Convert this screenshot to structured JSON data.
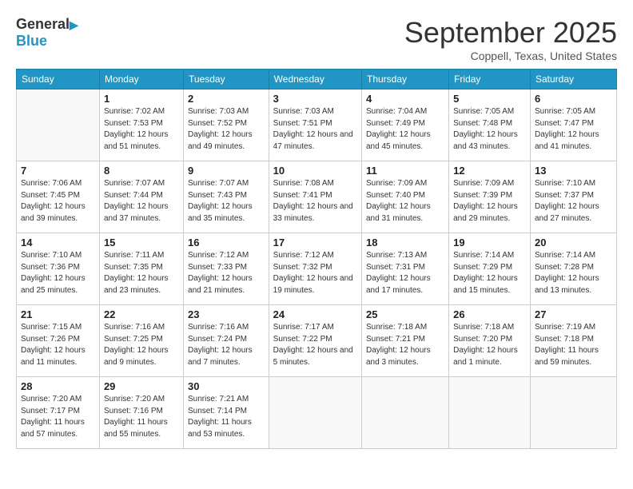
{
  "header": {
    "logo_line1": "General",
    "logo_line2": "Blue",
    "month": "September 2025",
    "location": "Coppell, Texas, United States"
  },
  "weekdays": [
    "Sunday",
    "Monday",
    "Tuesday",
    "Wednesday",
    "Thursday",
    "Friday",
    "Saturday"
  ],
  "weeks": [
    [
      {
        "day": "",
        "sunrise": "",
        "sunset": "",
        "daylight": ""
      },
      {
        "day": "1",
        "sunrise": "Sunrise: 7:02 AM",
        "sunset": "Sunset: 7:53 PM",
        "daylight": "Daylight: 12 hours and 51 minutes."
      },
      {
        "day": "2",
        "sunrise": "Sunrise: 7:03 AM",
        "sunset": "Sunset: 7:52 PM",
        "daylight": "Daylight: 12 hours and 49 minutes."
      },
      {
        "day": "3",
        "sunrise": "Sunrise: 7:03 AM",
        "sunset": "Sunset: 7:51 PM",
        "daylight": "Daylight: 12 hours and 47 minutes."
      },
      {
        "day": "4",
        "sunrise": "Sunrise: 7:04 AM",
        "sunset": "Sunset: 7:49 PM",
        "daylight": "Daylight: 12 hours and 45 minutes."
      },
      {
        "day": "5",
        "sunrise": "Sunrise: 7:05 AM",
        "sunset": "Sunset: 7:48 PM",
        "daylight": "Daylight: 12 hours and 43 minutes."
      },
      {
        "day": "6",
        "sunrise": "Sunrise: 7:05 AM",
        "sunset": "Sunset: 7:47 PM",
        "daylight": "Daylight: 12 hours and 41 minutes."
      }
    ],
    [
      {
        "day": "7",
        "sunrise": "Sunrise: 7:06 AM",
        "sunset": "Sunset: 7:45 PM",
        "daylight": "Daylight: 12 hours and 39 minutes."
      },
      {
        "day": "8",
        "sunrise": "Sunrise: 7:07 AM",
        "sunset": "Sunset: 7:44 PM",
        "daylight": "Daylight: 12 hours and 37 minutes."
      },
      {
        "day": "9",
        "sunrise": "Sunrise: 7:07 AM",
        "sunset": "Sunset: 7:43 PM",
        "daylight": "Daylight: 12 hours and 35 minutes."
      },
      {
        "day": "10",
        "sunrise": "Sunrise: 7:08 AM",
        "sunset": "Sunset: 7:41 PM",
        "daylight": "Daylight: 12 hours and 33 minutes."
      },
      {
        "day": "11",
        "sunrise": "Sunrise: 7:09 AM",
        "sunset": "Sunset: 7:40 PM",
        "daylight": "Daylight: 12 hours and 31 minutes."
      },
      {
        "day": "12",
        "sunrise": "Sunrise: 7:09 AM",
        "sunset": "Sunset: 7:39 PM",
        "daylight": "Daylight: 12 hours and 29 minutes."
      },
      {
        "day": "13",
        "sunrise": "Sunrise: 7:10 AM",
        "sunset": "Sunset: 7:37 PM",
        "daylight": "Daylight: 12 hours and 27 minutes."
      }
    ],
    [
      {
        "day": "14",
        "sunrise": "Sunrise: 7:10 AM",
        "sunset": "Sunset: 7:36 PM",
        "daylight": "Daylight: 12 hours and 25 minutes."
      },
      {
        "day": "15",
        "sunrise": "Sunrise: 7:11 AM",
        "sunset": "Sunset: 7:35 PM",
        "daylight": "Daylight: 12 hours and 23 minutes."
      },
      {
        "day": "16",
        "sunrise": "Sunrise: 7:12 AM",
        "sunset": "Sunset: 7:33 PM",
        "daylight": "Daylight: 12 hours and 21 minutes."
      },
      {
        "day": "17",
        "sunrise": "Sunrise: 7:12 AM",
        "sunset": "Sunset: 7:32 PM",
        "daylight": "Daylight: 12 hours and 19 minutes."
      },
      {
        "day": "18",
        "sunrise": "Sunrise: 7:13 AM",
        "sunset": "Sunset: 7:31 PM",
        "daylight": "Daylight: 12 hours and 17 minutes."
      },
      {
        "day": "19",
        "sunrise": "Sunrise: 7:14 AM",
        "sunset": "Sunset: 7:29 PM",
        "daylight": "Daylight: 12 hours and 15 minutes."
      },
      {
        "day": "20",
        "sunrise": "Sunrise: 7:14 AM",
        "sunset": "Sunset: 7:28 PM",
        "daylight": "Daylight: 12 hours and 13 minutes."
      }
    ],
    [
      {
        "day": "21",
        "sunrise": "Sunrise: 7:15 AM",
        "sunset": "Sunset: 7:26 PM",
        "daylight": "Daylight: 12 hours and 11 minutes."
      },
      {
        "day": "22",
        "sunrise": "Sunrise: 7:16 AM",
        "sunset": "Sunset: 7:25 PM",
        "daylight": "Daylight: 12 hours and 9 minutes."
      },
      {
        "day": "23",
        "sunrise": "Sunrise: 7:16 AM",
        "sunset": "Sunset: 7:24 PM",
        "daylight": "Daylight: 12 hours and 7 minutes."
      },
      {
        "day": "24",
        "sunrise": "Sunrise: 7:17 AM",
        "sunset": "Sunset: 7:22 PM",
        "daylight": "Daylight: 12 hours and 5 minutes."
      },
      {
        "day": "25",
        "sunrise": "Sunrise: 7:18 AM",
        "sunset": "Sunset: 7:21 PM",
        "daylight": "Daylight: 12 hours and 3 minutes."
      },
      {
        "day": "26",
        "sunrise": "Sunrise: 7:18 AM",
        "sunset": "Sunset: 7:20 PM",
        "daylight": "Daylight: 12 hours and 1 minute."
      },
      {
        "day": "27",
        "sunrise": "Sunrise: 7:19 AM",
        "sunset": "Sunset: 7:18 PM",
        "daylight": "Daylight: 11 hours and 59 minutes."
      }
    ],
    [
      {
        "day": "28",
        "sunrise": "Sunrise: 7:20 AM",
        "sunset": "Sunset: 7:17 PM",
        "daylight": "Daylight: 11 hours and 57 minutes."
      },
      {
        "day": "29",
        "sunrise": "Sunrise: 7:20 AM",
        "sunset": "Sunset: 7:16 PM",
        "daylight": "Daylight: 11 hours and 55 minutes."
      },
      {
        "day": "30",
        "sunrise": "Sunrise: 7:21 AM",
        "sunset": "Sunset: 7:14 PM",
        "daylight": "Daylight: 11 hours and 53 minutes."
      },
      {
        "day": "",
        "sunrise": "",
        "sunset": "",
        "daylight": ""
      },
      {
        "day": "",
        "sunrise": "",
        "sunset": "",
        "daylight": ""
      },
      {
        "day": "",
        "sunrise": "",
        "sunset": "",
        "daylight": ""
      },
      {
        "day": "",
        "sunrise": "",
        "sunset": "",
        "daylight": ""
      }
    ]
  ]
}
